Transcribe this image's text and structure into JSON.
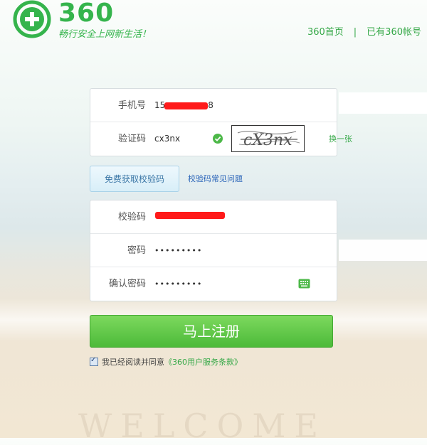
{
  "header": {
    "logo_text": "360",
    "slogan": "畅行安全上网新生活！",
    "nav_home": "360首页",
    "nav_separator": "|",
    "nav_has_account": "已有360帐号"
  },
  "form": {
    "phone": {
      "label": "手机号",
      "value_prefix": "15",
      "value_suffix": "8"
    },
    "captcha": {
      "label": "验证码",
      "value": "cx3nx",
      "image_text": "cX3nx",
      "refresh_label": "换一张"
    },
    "get_code_button": "免费获取校验码",
    "code_faq_link": "校验码常见问题",
    "verify_code": {
      "label": "校验码"
    },
    "password": {
      "label": "密码",
      "value": "•••••••••"
    },
    "confirm_password": {
      "label": "确认密码",
      "value": "•••••••••"
    },
    "submit_button": "马上注册",
    "agreement_text": "我已经阅读并同意",
    "agreement_link": "《360用户服务条款》"
  },
  "background": {
    "sand_text": "WELCOME"
  },
  "colors": {
    "brand_green": "#35b44c",
    "button_green": "#4cba39",
    "link_blue": "#2a64b8",
    "redaction_red": "#ff1a1a"
  }
}
